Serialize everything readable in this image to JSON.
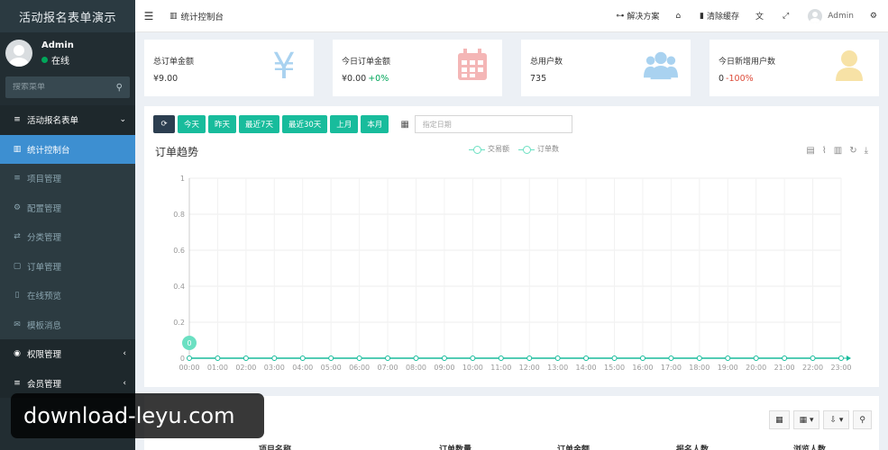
{
  "app_title": "活动报名表单演示",
  "user": {
    "name": "Admin",
    "status": "在线"
  },
  "sidebar": {
    "search_placeholder": "搜索菜单",
    "items": [
      {
        "label": "活动报名表单",
        "icon": "list-icon",
        "kind": "group",
        "arrow": "⌄"
      },
      {
        "label": "统计控制台",
        "icon": "bar-chart-icon",
        "kind": "active"
      },
      {
        "label": "项目管理",
        "icon": "list-icon",
        "kind": "sub"
      },
      {
        "label": "配置管理",
        "icon": "gear-icon",
        "kind": "sub"
      },
      {
        "label": "分类管理",
        "icon": "sort-icon",
        "kind": "sub"
      },
      {
        "label": "订单管理",
        "icon": "file-icon",
        "kind": "sub"
      },
      {
        "label": "在线预览",
        "icon": "mobile-icon",
        "kind": "sub"
      },
      {
        "label": "模板消息",
        "icon": "envelope-icon",
        "kind": "sub"
      },
      {
        "label": "权限管理",
        "icon": "users-icon",
        "kind": "group",
        "arrow": "‹"
      },
      {
        "label": "会员管理",
        "icon": "list-icon",
        "kind": "group",
        "arrow": "‹"
      }
    ]
  },
  "topbar": {
    "tab_label": "统计控制台",
    "links": [
      {
        "label": "解决方案",
        "icon": "sitemap-icon"
      },
      {
        "label": "",
        "icon": "home-icon"
      },
      {
        "label": "清除缓存",
        "icon": "trash-icon"
      },
      {
        "label": "",
        "icon": "translate-icon"
      },
      {
        "label": "",
        "icon": "fullscreen-icon"
      }
    ],
    "admin_label": "Admin"
  },
  "cards": [
    {
      "title": "总订单金额",
      "value": "¥9.00",
      "pct": "",
      "pct_kind": "",
      "icon": "yen-icon",
      "color": "#a9d2f0"
    },
    {
      "title": "今日订单金额",
      "value": "¥0.00",
      "pct": "+0%",
      "pct_kind": "up",
      "icon": "calendar-icon",
      "color": "#f4b6b6"
    },
    {
      "title": "总用户数",
      "value": "735",
      "pct": "",
      "pct_kind": "",
      "icon": "group-icon",
      "color": "#a9d2f0"
    },
    {
      "title": "今日新增用户数",
      "value": "0",
      "pct": "-100%",
      "pct_kind": "down",
      "icon": "user-icon",
      "color": "#f7e2a6"
    }
  ],
  "filters": {
    "buttons": [
      "今天",
      "昨天",
      "最近7天",
      "最近30天",
      "上月",
      "本月"
    ],
    "date_placeholder": "指定日期"
  },
  "chart_data": {
    "type": "line",
    "title": "订单趋势",
    "legend": [
      "交易额",
      "订单数"
    ],
    "categories": [
      "00:00",
      "01:00",
      "02:00",
      "03:00",
      "04:00",
      "05:00",
      "06:00",
      "07:00",
      "08:00",
      "09:00",
      "10:00",
      "11:00",
      "12:00",
      "13:00",
      "14:00",
      "15:00",
      "16:00",
      "17:00",
      "18:00",
      "19:00",
      "20:00",
      "21:00",
      "22:00",
      "23:00"
    ],
    "yticks": [
      0,
      0.2,
      0.4,
      0.6,
      0.8,
      1
    ],
    "ylim": [
      0,
      1
    ],
    "series": [
      {
        "name": "订单数",
        "values": [
          0,
          0,
          0,
          0,
          0,
          0,
          0,
          0,
          0,
          0,
          0,
          0,
          0,
          0,
          0,
          0,
          0,
          0,
          0,
          0,
          0,
          0,
          0,
          0
        ]
      }
    ],
    "marker_label": "0",
    "color": "#18bc9c",
    "grid": true
  },
  "bottom": {
    "columns": [
      "项目名称",
      "订单数量",
      "订单金额",
      "报名人数",
      "浏览人数"
    ]
  },
  "watermark": "download-leyu.com"
}
